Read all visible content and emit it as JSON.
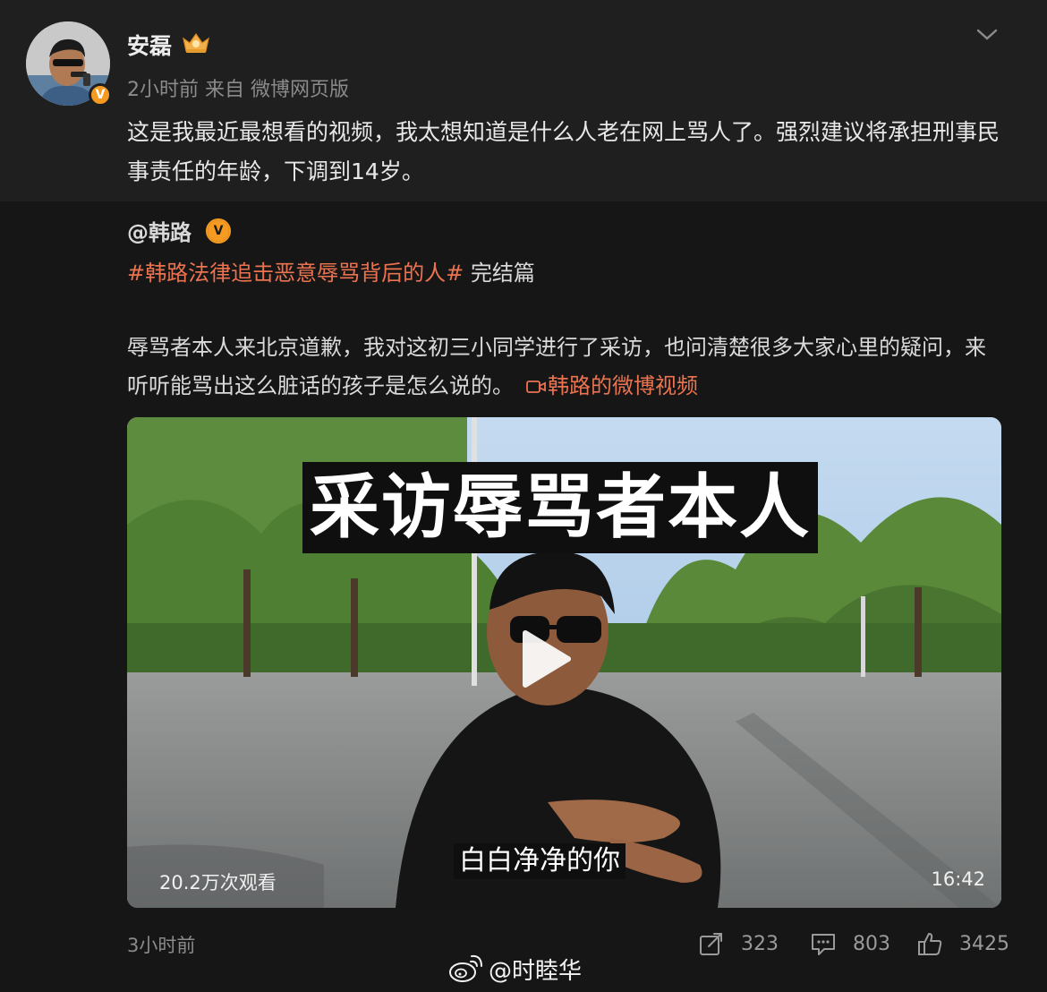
{
  "post": {
    "username": "安磊",
    "meta": "2小时前  来自 微博网页版",
    "text": "这是我最近最想看的视频，我太想知道是什么人老在网上骂人了。强烈建议将承担刑事民事责任的年龄，下调到14岁。",
    "verified_badge": "V",
    "crown_icon": "crown-icon",
    "menu_icon": "chevron-down-icon"
  },
  "repost": {
    "author": "@韩路",
    "verified_badge": "V",
    "topic": "#韩路法律追击恶意辱骂背后的人#",
    "topic_suffix": " 完结篇",
    "text": "辱骂者本人来北京道歉，我对这初三小同学进行了采访，也问清楚很多大家心里的疑问，来听听能骂出这么脏话的孩子是怎么说的。",
    "video_link": "韩路的微博视频",
    "video": {
      "title_overlay": "采访辱骂者本人",
      "subtitle": "白白净净的你",
      "views": "20.2万次观看",
      "duration": "16:42"
    },
    "time": "3小时前",
    "actions": {
      "share": "323",
      "comment": "803",
      "like": "3425"
    },
    "watermark": "@时睦华"
  },
  "colors": {
    "background": "#1f1f1f",
    "repost_background": "#161616",
    "accent_orange": "#eb7350",
    "badge_orange": "#f59b22"
  }
}
